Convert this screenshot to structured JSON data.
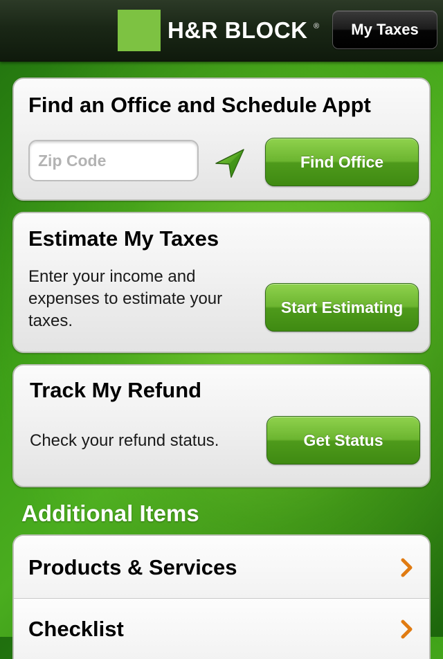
{
  "header": {
    "brand_name": "H&R BLOCK",
    "brand_registered_mark": "®",
    "brand_color": "#7dc242",
    "my_taxes_label": "My Taxes"
  },
  "find_office": {
    "title": "Find an Office and Schedule Appt",
    "zip_placeholder": "Zip Code",
    "zip_value": "",
    "locate_icon": "location-arrow-icon",
    "button_label": "Find Office"
  },
  "estimate": {
    "title": "Estimate My Taxes",
    "description": "Enter your income and expenses to estimate your taxes.",
    "button_label": "Start Estimating"
  },
  "refund": {
    "title": "Track My Refund",
    "description": "Check your refund status.",
    "button_label": "Get Status"
  },
  "additional": {
    "heading": "Additional Items",
    "items": [
      {
        "label": "Products & Services",
        "icon": "chevron-right-icon"
      },
      {
        "label": "Checklist",
        "icon": "chevron-right-icon"
      }
    ],
    "chevron_color": "#e07b12"
  },
  "colors": {
    "button_green": "#5aa724",
    "background_green": "#3c9e17",
    "header_dark": "#1a2716"
  }
}
